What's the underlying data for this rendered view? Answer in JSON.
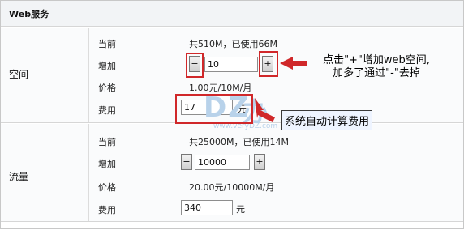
{
  "header": {
    "title": "Web服务"
  },
  "space": {
    "section_label": "空间",
    "current_label": "当前",
    "current_value": "共510M，已使用66M",
    "add_label": "增加",
    "minus_label": "−",
    "quantity_value": "10",
    "plus_label": "+",
    "price_label": "价格",
    "price_value": "1.00元/10M/月",
    "cost_label": "费用",
    "cost_value": "17",
    "cost_unit": "元"
  },
  "traffic": {
    "section_label": "流量",
    "current_label": "当前",
    "current_value": "共25000M，已使用14M",
    "add_label": "增加",
    "minus_label": "−",
    "quantity_value": "10000",
    "plus_label": "+",
    "price_label": "价格",
    "price_value": "20.00元/10000M/月",
    "cost_label": "费用",
    "cost_value": "340",
    "cost_unit": "元"
  },
  "annotations": {
    "plus_note_line1": "点击\"+\"增加web空间,",
    "plus_note_line2": "加多了通过\"-\"去掉",
    "auto_calc_note": "系统自动计算费用"
  },
  "watermark": {
    "main": "DZ",
    "sub": "办",
    "url": "www.veryDZ.com"
  },
  "colors": {
    "annotation_red": "#d0282a",
    "header_bg": "#f2f4f6",
    "tooltip_bg": "#eef4ff"
  }
}
